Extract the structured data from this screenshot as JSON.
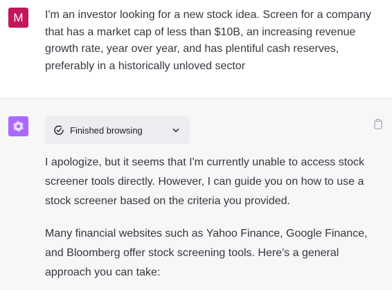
{
  "user_message": {
    "avatar_letter": "M",
    "text": "I'm an investor looking for a new stock idea. Screen for a company that has a market cap of less than $10B, an increasing revenue growth rate, year over year, and has plentiful cash reserves, preferably in a historically unloved sector"
  },
  "assistant_message": {
    "avatar_icon": "openai-logo-icon",
    "browsing_status": "Finished browsing",
    "paragraphs": [
      "I apologize, but it seems that I'm currently unable to access stock screener tools directly. However, I can guide you on how to use a stock screener based on the criteria you provided.",
      "Many financial websites such as Yahoo Finance, Google Finance, and Bloomberg offer stock screening tools. Here's a general approach you can take:"
    ]
  },
  "icons": {
    "copy": "clipboard-icon",
    "status": "check-circle-icon",
    "expand": "chevron-down-icon"
  },
  "colors": {
    "user_avatar_bg": "#c2185b",
    "assistant_avatar_bg": "#ab68ff",
    "assistant_block_bg": "#f7f7f8",
    "pill_bg": "#ececf1"
  }
}
